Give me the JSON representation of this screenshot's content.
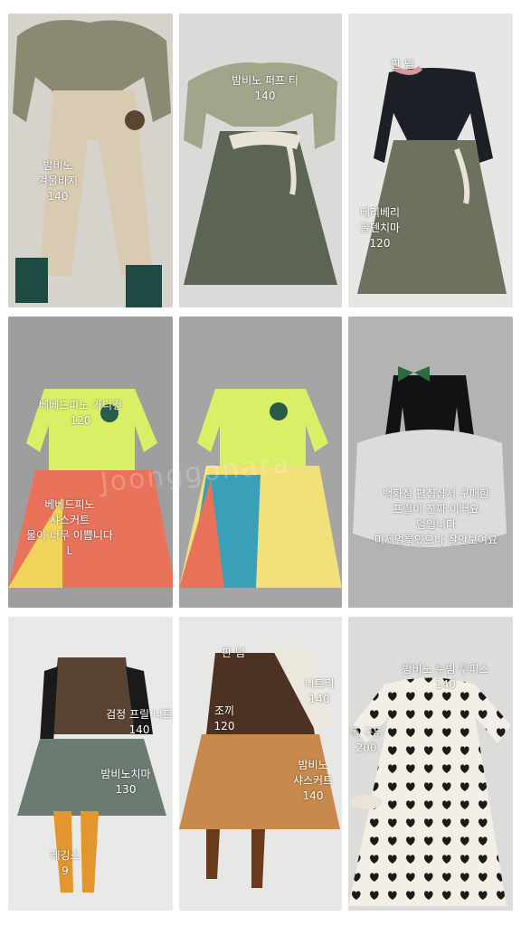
{
  "watermark": "Joonggonara",
  "tiles": [
    {
      "id": "t1",
      "lines": [
        "밤비노",
        "겨울바지",
        "140"
      ]
    },
    {
      "id": "t2",
      "lines": [
        "밤비노 퍼프 티",
        "140"
      ]
    },
    {
      "id": "t3a",
      "lines": [
        "판 덤"
      ]
    },
    {
      "id": "t3b",
      "lines": [
        "테리베리",
        "골덴치마",
        "120"
      ]
    },
    {
      "id": "t4a",
      "lines": [
        "베베드피노 가디건",
        "120"
      ]
    },
    {
      "id": "t4b",
      "lines": [
        "베베드피노",
        "샤스커트",
        "물이 너무 이쁩니다",
        "L"
      ]
    },
    {
      "id": "t6",
      "lines": [
        "백화점 편집샵서 구매한",
        "프릴이 진짜 이뻐요",
        "덤입니다",
        "미세얼룩있으나 잘안보여요"
      ]
    },
    {
      "id": "t7a",
      "lines": [
        "검정 프릴 니트",
        "140"
      ]
    },
    {
      "id": "t7b",
      "lines": [
        "밤비노치마",
        "130"
      ]
    },
    {
      "id": "t7c",
      "lines": [
        "레깅스",
        "9"
      ]
    },
    {
      "id": "t8a",
      "lines": [
        "판 덤"
      ]
    },
    {
      "id": "t8b",
      "lines": [
        "니트티",
        "140"
      ]
    },
    {
      "id": "t8c",
      "lines": [
        "조끼",
        "120"
      ]
    },
    {
      "id": "t8d",
      "lines": [
        "밤비노",
        "샤스커트",
        "140"
      ]
    },
    {
      "id": "t9a",
      "lines": [
        "밤비노 누빔 투피스",
        "140"
      ]
    },
    {
      "id": "t9b",
      "lines": [
        "독 구두",
        "200"
      ]
    }
  ]
}
